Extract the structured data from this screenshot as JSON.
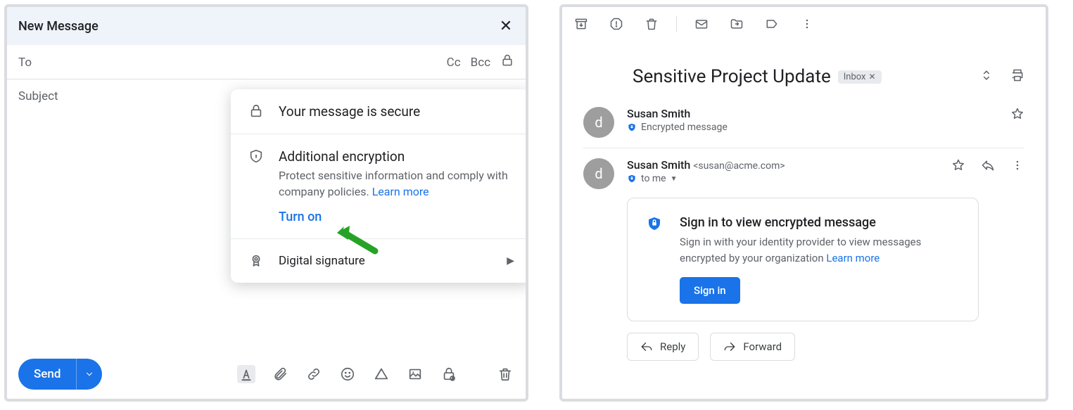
{
  "compose": {
    "title": "New Message",
    "to_label": "To",
    "cc_label": "Cc",
    "bcc_label": "Bcc",
    "subject_placeholder": "Subject",
    "send_label": "Send"
  },
  "security_popup": {
    "secure_title": "Your message is secure",
    "enc_title": "Additional encryption",
    "enc_desc": "Protect sensitive information and comply with company policies. ",
    "learn_more": "Learn more",
    "turn_on": "Turn on",
    "ds_title": "Digital signature"
  },
  "message": {
    "subject": "Sensitive Project Update",
    "inbox_chip": "Inbox",
    "sender1_name": "Susan Smith",
    "sender1_sub": "Encrypted message",
    "sender2_name": "Susan Smith",
    "sender2_email": "<susan@acme.com>",
    "sender2_to": "to me",
    "card_title": "Sign in to view encrypted message",
    "card_desc": "Sign in with your identity provider to view messages encrypted by your organization  ",
    "card_learn": "Learn  more",
    "signin_btn": "Sign in",
    "reply": "Reply",
    "forward": "Forward"
  }
}
